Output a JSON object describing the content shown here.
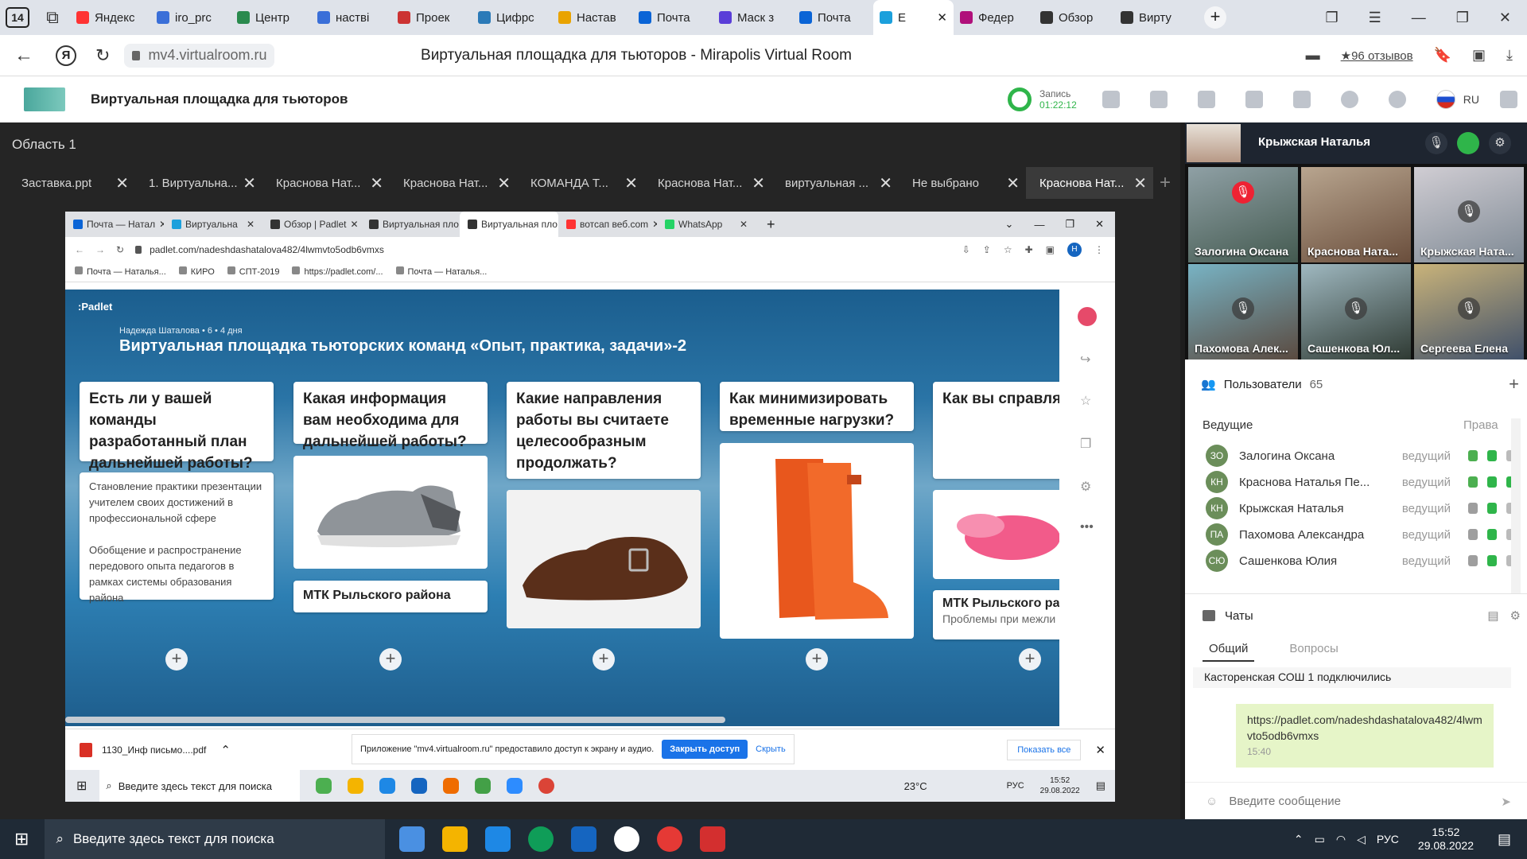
{
  "browser": {
    "counter": "14",
    "tabs": [
      {
        "label": "Яндекс",
        "color": "#f33"
      },
      {
        "label": "iro_prc",
        "color": "#3a6fd8"
      },
      {
        "label": "Центр",
        "color": "#2a8a4e"
      },
      {
        "label": "настві",
        "color": "#3a6fd8"
      },
      {
        "label": "Проек",
        "color": "#c33"
      },
      {
        "label": "Цифрс",
        "color": "#2b7ab8"
      },
      {
        "label": "Настав",
        "color": "#e9a300"
      },
      {
        "label": "Почта",
        "color": "#0a64d6"
      },
      {
        "label": "Маск з",
        "color": "#5a3ed8"
      },
      {
        "label": "Почта",
        "color": "#0a64d6"
      },
      {
        "label": "Е",
        "color": "#1ca0dc",
        "active": true
      },
      {
        "label": "Федер",
        "color": "#b0107a"
      },
      {
        "label": "Обзор",
        "color": "#333"
      },
      {
        "label": "Вирту",
        "color": "#333"
      }
    ],
    "url": "mv4.virtualroom.ru",
    "page_title": "Виртуальная площадка для тьюторов - Mirapolis Virtual Room",
    "reviews": "★96 отзывов"
  },
  "app": {
    "title": "Виртуальная площадка для тьюторов",
    "record_label": "Запись",
    "record_time": "01:22:12",
    "lang": "RU"
  },
  "stage": {
    "area_title": "Область 1",
    "doc_tabs": [
      "Заставка.ppt",
      "1. Виртуальна...",
      "Краснова Нат...",
      "Краснова Нат...",
      "КОМАНДА Т...",
      "Краснова Нат...",
      "виртуальная ...",
      "Не выбрано",
      "Краснова Нат..."
    ]
  },
  "shared": {
    "tabs": [
      {
        "label": "Почта — Натал",
        "color": "#0a64d6"
      },
      {
        "label": "Виртуальна",
        "color": "#1ca0dc"
      },
      {
        "label": "Обзор | Padlet",
        "color": "#333"
      },
      {
        "label": "Виртуальная пло",
        "color": "#333"
      },
      {
        "label": "Виртуальная пло",
        "color": "#333",
        "active": true
      },
      {
        "label": "вотсап веб.com",
        "color": "#f33"
      },
      {
        "label": "WhatsApp",
        "color": "#25d366"
      }
    ],
    "url": "padlet.com/nadeshdashatalova482/4lwmvto5odb6vmxs",
    "bookmarks": [
      "Почта — Наталья...",
      "КИРО",
      "СПТ-2019",
      "https://padlet.com/...",
      "Почта — Наталья..."
    ],
    "padlet": {
      "brand": ":Padlet",
      "author": "Надежда Шаталова • 6 • 4 дня",
      "title": "Виртуальная площадка тьюторских команд «Опыт, практика, задачи»-2",
      "columns": [
        {
          "heading": "Есть ли у вашей команды разработанный план дальнейшей работы?",
          "text1": "Становление практики презентации учителем своих достижений в профессиональной сфере",
          "text2": "Обобщение и распространение передового опыта педагогов в рамках системы образования района"
        },
        {
          "heading": "Какая информация вам необходима для дальнейшей работы?",
          "caption": "МТК Рыльского района"
        },
        {
          "heading": "Какие направления работы вы считаете целесообразным продолжать?"
        },
        {
          "heading": "Как минимизировать временные нагрузки?"
        },
        {
          "heading": "Как вы справля проблемами межличностно взаимодейств",
          "caption": "МТК Рыльского ра",
          "subtext": "Проблемы при межли"
        }
      ]
    },
    "download": {
      "file": "1130_Инф письмо....pdf",
      "notice": "Приложение \"mv4.virtualroom.ru\" предоставило доступ к экрану и аудио.",
      "stop": "Закрыть доступ",
      "hide": "Скрыть",
      "show_all": "Показать все"
    },
    "taskbar": {
      "search": "Введите здесь текст для поиска",
      "temp": "23°C",
      "lang": "РУС",
      "time": "15:52",
      "date": "29.08.2022"
    }
  },
  "panel": {
    "presenter": "Крыжская Наталья",
    "videos": [
      "Залогина Оксана",
      "Краснова Ната...",
      "Крыжская Ната...",
      "Пахомова Алек...",
      "Сашенкова Юл...",
      "Сергеева Елена"
    ],
    "users_label": "Пользователи",
    "users_count": "65",
    "hosts_label": "Ведущие",
    "rights_label": "Права",
    "users": [
      {
        "initials": "ЗО",
        "name": "Залогина Оксана",
        "role": "ведущий"
      },
      {
        "initials": "КН",
        "name": "Краснова Наталья Пе...",
        "role": "ведущий"
      },
      {
        "initials": "КН",
        "name": "Крыжская Наталья",
        "role": "ведущий"
      },
      {
        "initials": "ПА",
        "name": "Пахомова Александра",
        "role": "ведущий"
      },
      {
        "initials": "СЮ",
        "name": "Сашенкова Юлия",
        "role": "ведущий"
      }
    ],
    "chats_label": "Чаты",
    "chat_tabs": [
      "Общий",
      "Вопросы"
    ],
    "messages": [
      {
        "text": "Касторенская СОШ 1 подключились"
      },
      {
        "text": "https://padlet.com/nadeshdashatalova482/4lwmvto5odb6vmxs",
        "time": "15:40"
      }
    ],
    "input_placeholder": "Введите сообщение"
  },
  "taskbar": {
    "search": "Введите здесь текст для поиска",
    "lang": "РУС",
    "time": "15:52",
    "date": "29.08.2022"
  }
}
